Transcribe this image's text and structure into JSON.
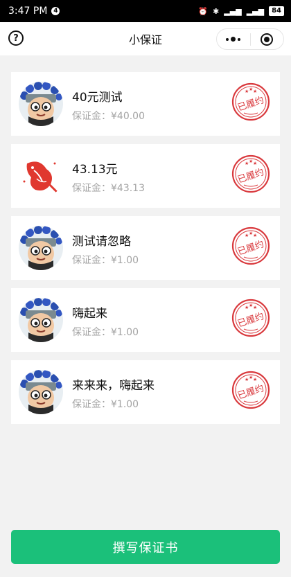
{
  "status_bar": {
    "time": "3:47 PM",
    "notification_badge": "4",
    "battery": "84"
  },
  "nav": {
    "title": "小保证",
    "help_glyph": "?"
  },
  "deposit_label": "保证金：",
  "stamp_text": "已履约",
  "items": [
    {
      "title": "40元测试",
      "amount": "¥40.00",
      "avatar": "cartoon-avatar"
    },
    {
      "title": "43.13元",
      "amount": "¥43.13",
      "avatar": "red-bird-avatar"
    },
    {
      "title": "测试请忽略",
      "amount": "¥1.00",
      "avatar": "cartoon-avatar"
    },
    {
      "title": "嗨起来",
      "amount": "¥1.00",
      "avatar": "cartoon-avatar"
    },
    {
      "title": "来来来，嗨起来",
      "amount": "¥1.00",
      "avatar": "cartoon-avatar"
    }
  ],
  "bottom_button": {
    "label": "撰写保证书"
  },
  "colors": {
    "accent": "#1bc07a",
    "stamp_red": "#d9393d",
    "background": "#f2f2f2"
  }
}
